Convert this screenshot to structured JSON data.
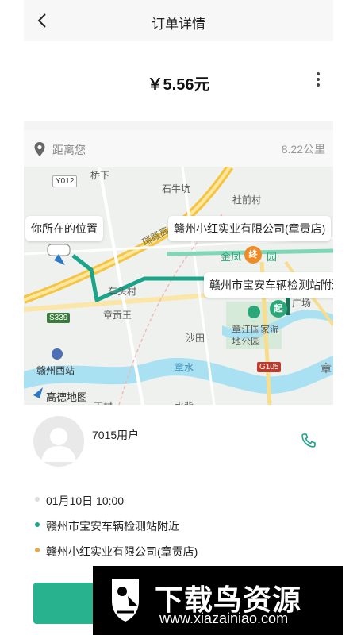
{
  "header": {
    "title": "订单详情",
    "back_icon": "chevron-left-icon"
  },
  "order": {
    "price": "￥5.56元",
    "more_icon": "more-vertical-icon"
  },
  "distance": {
    "label": "距离您",
    "value": "8.22公里",
    "icon": "location-pin-icon"
  },
  "map": {
    "bubbles": {
      "current": "你所在的位置",
      "destination": "赣州小红实业有限公司(章贡店)",
      "start": "赣州市宝安车辆检测站附近"
    },
    "pins": {
      "end": "终",
      "start": "起"
    },
    "labels": {
      "y012": "Y012",
      "qiaoxia": "桥下",
      "shiniukeng": "石牛坑",
      "sheqiancun": "社前村",
      "ruijin": "瑞赣高",
      "jinfeng": "金凤",
      "yuan": "园",
      "chehucun": "车头村",
      "zhanggongwang": "章贡王",
      "s339": "S339",
      "shatian": "沙田",
      "guangchang": "广场",
      "wetland": "章江国家湿地公园",
      "ganzhouxi": "赣州西站",
      "zhangshui": "章水",
      "g105": "G105",
      "zhang": "章",
      "amap": "高德地图",
      "xiacun": "下村",
      "shuibei": "水背"
    },
    "colors": {
      "route": "#1aa58a",
      "destination_pin": "#f08a24",
      "start_pin": "#2aa87a"
    }
  },
  "user": {
    "name": "7015用户",
    "phone_icon": "phone-icon"
  },
  "info": {
    "time": "01月10日 10:00",
    "from": "赣州市宝安车辆检测站附近",
    "to": "赣州小红实业有限公司(章贡店)",
    "colors": {
      "time_dot": "#dddddd",
      "from_dot": "#1aa58a",
      "to_dot": "#e8a64a"
    }
  },
  "watermark": {
    "title": "下载鸟资源",
    "url": "www.xiazainiao.com"
  }
}
